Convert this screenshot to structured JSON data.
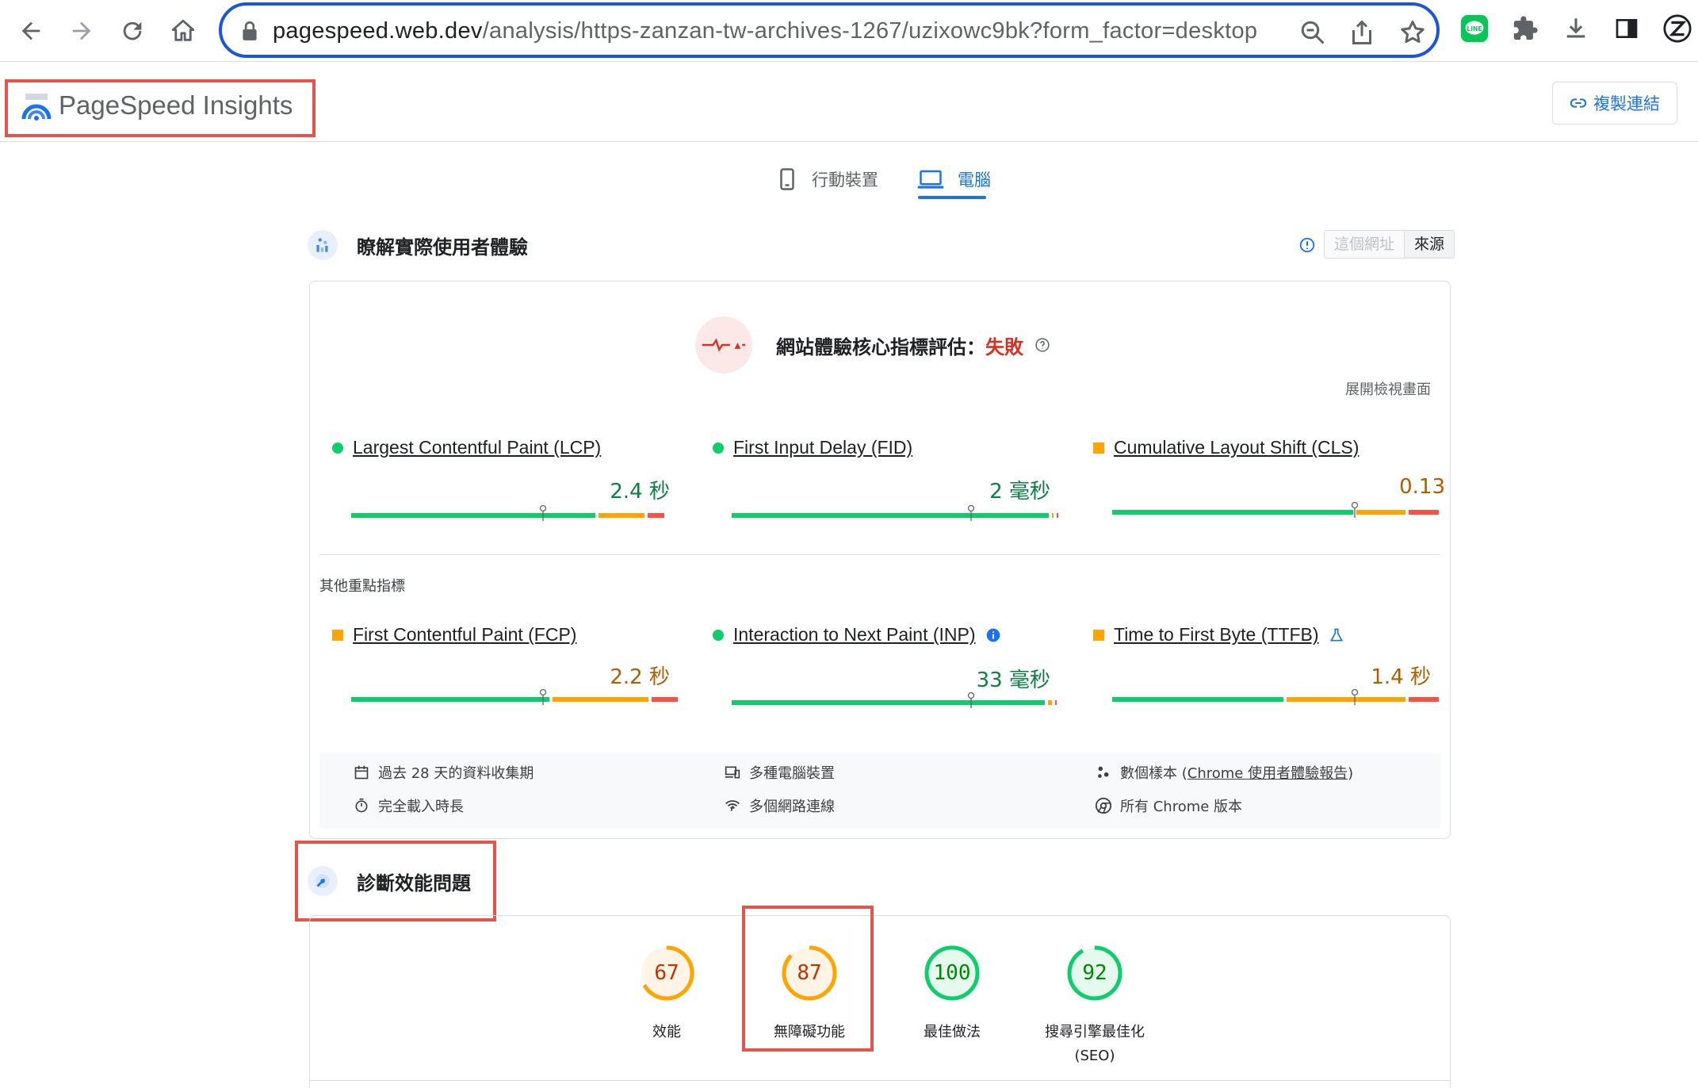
{
  "browser": {
    "url_host": "pagespeed.web.dev",
    "url_path": "/analysis/https-zanzan-tw-archives-1267/uzixowc9bk?form_factor=desktop"
  },
  "header": {
    "logo_text": "PageSpeed Insights",
    "copy_link_label": "複製連結"
  },
  "device_tabs": [
    {
      "label": "行動裝置",
      "active": false
    },
    {
      "label": "電腦",
      "active": true
    }
  ],
  "field_section": {
    "title": "瞭解實際使用者體驗",
    "toggle": {
      "this_url": "這個網址",
      "origin": "來源"
    },
    "cwv_label": "網站體驗核心指標評估：",
    "cwv_result": "失敗",
    "expand_view": "展開檢視畫面",
    "core_metrics": [
      {
        "name": "Largest Contentful Paint (LCP)",
        "value": "2.4 秒",
        "rating": "good",
        "distribution": [
          0.75,
          0.15,
          0.06
        ]
      },
      {
        "name": "First Input Delay (FID)",
        "value": "2 毫秒",
        "rating": "good",
        "distribution": [
          0.97,
          0.01,
          0.01
        ]
      },
      {
        "name": "Cumulative Layout Shift (CLS)",
        "value": "0.13",
        "rating": "average",
        "distribution": [
          0.74,
          0.16,
          0.1
        ]
      }
    ],
    "other_label": "其他重點指標",
    "other_metrics": [
      {
        "name": "First Contentful Paint (FCP)",
        "value": "2.2 秒",
        "rating": "average",
        "distribution": [
          0.61,
          0.3,
          0.09
        ]
      },
      {
        "name": "Interaction to Next Paint (INP)",
        "value": "33 毫秒",
        "rating": "good",
        "distribution": [
          0.96,
          0.02,
          0.01
        ]
      },
      {
        "name": "Time to First Byte (TTFB)",
        "value": "1.4 秒",
        "rating": "average",
        "distribution": [
          0.53,
          0.37,
          0.1
        ]
      }
    ],
    "meta": {
      "period": "過去 28 天的資料收集期",
      "devices": "多種電腦裝置",
      "samples_prefix": "數個樣本 (",
      "samples_link": "Chrome 使用者體驗報告",
      "samples_suffix": ")",
      "duration": "完全載入時長",
      "network": "多個網路連線",
      "chrome": "所有 Chrome 版本"
    }
  },
  "diagnose_section": {
    "title": "診斷效能問題",
    "scores": [
      {
        "label": "效能",
        "score": "67",
        "fraction": 0.67,
        "color": "#ffa400"
      },
      {
        "label": "無障礙功能",
        "score": "87",
        "fraction": 0.87,
        "color": "#ffa400"
      },
      {
        "label": "最佳做法",
        "score": "100",
        "fraction": 1.0,
        "color": "#0cce6b"
      },
      {
        "label": "搜尋引擎最佳化",
        "label2": "(SEO)",
        "score": "92",
        "fraction": 0.92,
        "color": "#0cce6b"
      }
    ]
  },
  "colors": {
    "good": "#0cce6b",
    "average": "#ffa400",
    "poor": "#ff4e42",
    "accent": "#1a73e8",
    "highlight": "#e5534b"
  }
}
